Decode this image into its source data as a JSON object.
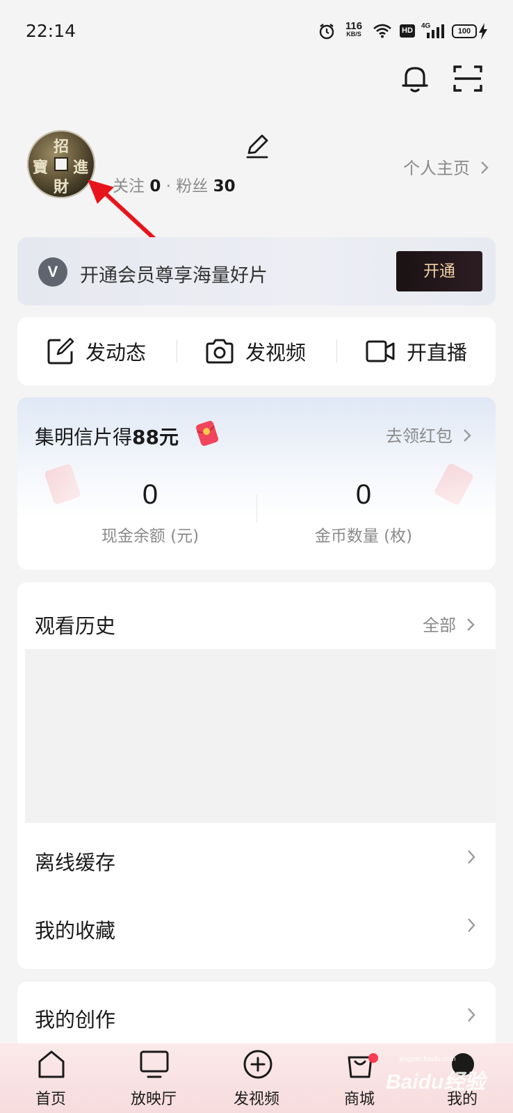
{
  "status_bar": {
    "time": "22:14",
    "net_speed": "116",
    "net_unit": "KB/S",
    "hd": "HD",
    "network": "4G",
    "battery": "100",
    "icons": [
      "alarm-icon",
      "wifi-icon",
      "signal-icon",
      "battery-icon",
      "charging-icon"
    ]
  },
  "top_actions": {
    "icons": [
      "bell-icon",
      "scan-icon"
    ]
  },
  "profile": {
    "avatar_chars": [
      "招",
      "進",
      "財",
      "寶"
    ],
    "follow_label": "关注",
    "follow_count": "0",
    "dot": "·",
    "fans_label": "粉丝",
    "fans_count": "30",
    "homepage_link": "个人主页"
  },
  "vip": {
    "logo": "V",
    "text": "开通会员尊享海量好片",
    "button": "开通"
  },
  "post_actions": [
    {
      "label": "发动态",
      "icon": "edit-square-icon"
    },
    {
      "label": "发视频",
      "icon": "camera-icon"
    },
    {
      "label": "开直播",
      "icon": "video-camera-icon"
    }
  ],
  "red_packet": {
    "title_prefix": "集明信片得",
    "title_amount": "88元",
    "link": "去领红包",
    "stats": [
      {
        "value": "0",
        "label": "现金余额 (元)"
      },
      {
        "value": "0",
        "label": "金币数量 (枚)"
      }
    ]
  },
  "history": {
    "title": "观看历史",
    "all_link": "全部"
  },
  "list_items": [
    {
      "label": "离线缓存"
    },
    {
      "label": "我的收藏"
    }
  ],
  "creation": {
    "label": "我的创作"
  },
  "bottom_nav": [
    {
      "label": "首页",
      "icon": "home-icon"
    },
    {
      "label": "放映厅",
      "icon": "tv-icon"
    },
    {
      "label": "发视频",
      "icon": "plus-circle-icon"
    },
    {
      "label": "商城",
      "icon": "shopping-bag-icon"
    },
    {
      "label": "我的",
      "icon": "profile-icon"
    }
  ],
  "watermark": {
    "text": "Baidu经验",
    "sub": "jingyan.baidu.com"
  },
  "colors": {
    "accent_red": "#ff3b4f",
    "vip_gold": "#f2d3a7",
    "annotation_red": "#e8141b"
  }
}
